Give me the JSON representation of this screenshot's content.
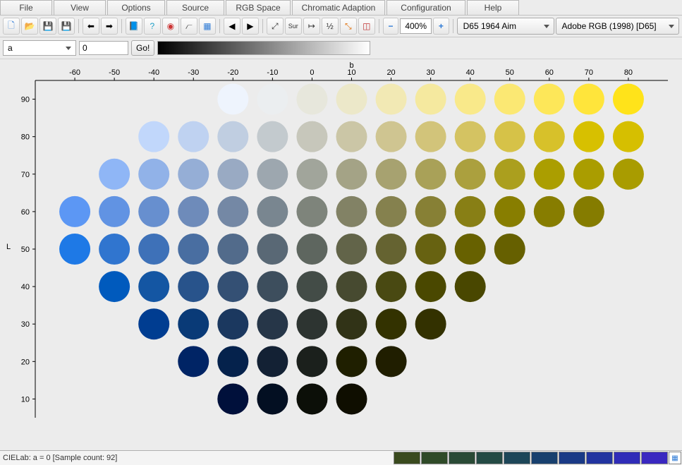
{
  "menubar": {
    "items": [
      {
        "label": "File",
        "w": 72
      },
      {
        "label": "View",
        "w": 72
      },
      {
        "label": "Options",
        "w": 80
      },
      {
        "label": "Source",
        "w": 80
      },
      {
        "label": "RGB Space",
        "w": 90
      },
      {
        "label": "Chromatic Adaption",
        "w": 130
      },
      {
        "label": "Configuration",
        "w": 110
      },
      {
        "label": "Help",
        "w": 72
      }
    ]
  },
  "toolbar": {
    "left_icons": [
      {
        "name": "new-doc-icon",
        "glyph": "🗋",
        "color": "#2d7ad6"
      },
      {
        "name": "open-icon",
        "glyph": "📂",
        "color": "#e2a33a"
      },
      {
        "name": "save-icon",
        "glyph": "💾",
        "color": "#3a6fb7"
      },
      {
        "name": "save-stop-icon",
        "glyph": "💾",
        "color": "#3a6fb7"
      }
    ],
    "nav_icons": [
      {
        "name": "import-icon",
        "glyph": "⬅",
        "color": "#000"
      },
      {
        "name": "export-icon",
        "glyph": "➡",
        "color": "#000"
      }
    ],
    "tool_icons": [
      {
        "name": "book-icon",
        "glyph": "📘",
        "color": "#2d7ad6"
      },
      {
        "name": "info-icon",
        "glyph": "?",
        "color": "#20a0c8"
      },
      {
        "name": "color-wheel-icon",
        "glyph": "◉",
        "color": "#cc3333"
      },
      {
        "name": "curve-icon",
        "glyph": "⦧",
        "color": "#555"
      },
      {
        "name": "palette-icon",
        "glyph": "▦",
        "color": "#2d7ad6"
      }
    ],
    "arrow_icons": [
      {
        "name": "prev-icon",
        "glyph": "◀",
        "color": "#000"
      },
      {
        "name": "next-icon",
        "glyph": "▶",
        "color": "#000"
      }
    ],
    "fit_icons": [
      {
        "name": "resize-icon",
        "glyph": "⤢",
        "color": "#333"
      },
      {
        "name": "sur-icon",
        "glyph": "Sur",
        "color": "#333",
        "small": true
      },
      {
        "name": "spacing-icon",
        "glyph": "↦",
        "color": "#333"
      },
      {
        "name": "half-icon",
        "glyph": "½",
        "color": "#333"
      },
      {
        "name": "expand-icon",
        "glyph": "⤡",
        "color": "#e06a00"
      },
      {
        "name": "bounds-icon",
        "glyph": "◫",
        "color": "#c03333"
      }
    ],
    "zoom": {
      "minus": "−",
      "plus": "+",
      "value": "400%"
    },
    "aim_combo": {
      "label": "D65 1964 Aim"
    },
    "space_combo": {
      "label": "Adobe RGB (1998) [D65]"
    }
  },
  "row2": {
    "selector": {
      "value": "a"
    },
    "input_value": "0",
    "go_label": "Go!"
  },
  "status": {
    "text": "CIELab: a = 0  [Sample count: 92]"
  },
  "chart_data": {
    "type": "scatter",
    "title": "",
    "xlabel": "b",
    "ylabel": "L",
    "x_ticks": [
      -60,
      -50,
      -40,
      -30,
      -20,
      -10,
      0,
      10,
      20,
      30,
      40,
      50,
      60,
      70,
      80
    ],
    "y_ticks": [
      10,
      20,
      30,
      40,
      50,
      60,
      70,
      80,
      90
    ],
    "xlim": [
      -70,
      90
    ],
    "ylim": [
      5,
      95
    ],
    "note": "CIELab gamut slice at a=0; each point is a color swatch at (b,L)",
    "points": [
      {
        "b": -20,
        "L": 90,
        "c": "#eef4fd"
      },
      {
        "b": -10,
        "L": 90,
        "c": "#ebeef0"
      },
      {
        "b": 0,
        "L": 90,
        "c": "#e7e7dc"
      },
      {
        "b": 10,
        "L": 90,
        "c": "#ece8c9"
      },
      {
        "b": 20,
        "L": 90,
        "c": "#f2e9b4"
      },
      {
        "b": 30,
        "L": 90,
        "c": "#f5e99f"
      },
      {
        "b": 40,
        "L": 90,
        "c": "#f9e98a"
      },
      {
        "b": 50,
        "L": 90,
        "c": "#fbe873"
      },
      {
        "b": 60,
        "L": 90,
        "c": "#fde759"
      },
      {
        "b": 70,
        "L": 90,
        "c": "#ffe53b"
      },
      {
        "b": 80,
        "L": 90,
        "c": "#ffe31a"
      },
      {
        "b": -40,
        "L": 80,
        "c": "#c1d7fb"
      },
      {
        "b": -30,
        "L": 80,
        "c": "#bfd2f1"
      },
      {
        "b": -20,
        "L": 80,
        "c": "#c0cee1"
      },
      {
        "b": -10,
        "L": 80,
        "c": "#c3cace"
      },
      {
        "b": 0,
        "L": 80,
        "c": "#c7c7bb"
      },
      {
        "b": 10,
        "L": 80,
        "c": "#cbc6a6"
      },
      {
        "b": 20,
        "L": 80,
        "c": "#cfc591"
      },
      {
        "b": 30,
        "L": 80,
        "c": "#d2c47a"
      },
      {
        "b": 40,
        "L": 80,
        "c": "#d4c362"
      },
      {
        "b": 50,
        "L": 80,
        "c": "#d6c248"
      },
      {
        "b": 60,
        "L": 80,
        "c": "#d7c12a"
      },
      {
        "b": 70,
        "L": 80,
        "c": "#d7c000"
      },
      {
        "b": 80,
        "L": 80,
        "c": "#d6bf00"
      },
      {
        "b": -50,
        "L": 70,
        "c": "#8fb6f6"
      },
      {
        "b": -40,
        "L": 70,
        "c": "#91b2e8"
      },
      {
        "b": -30,
        "L": 70,
        "c": "#95aed6"
      },
      {
        "b": -20,
        "L": 70,
        "c": "#99aac3"
      },
      {
        "b": -10,
        "L": 70,
        "c": "#9da7af"
      },
      {
        "b": 0,
        "L": 70,
        "c": "#a1a59b"
      },
      {
        "b": 10,
        "L": 70,
        "c": "#a4a386"
      },
      {
        "b": 20,
        "L": 70,
        "c": "#a7a270"
      },
      {
        "b": 30,
        "L": 70,
        "c": "#a9a158"
      },
      {
        "b": 40,
        "L": 70,
        "c": "#aba03e"
      },
      {
        "b": 50,
        "L": 70,
        "c": "#ab9f1e"
      },
      {
        "b": 60,
        "L": 70,
        "c": "#ab9e00"
      },
      {
        "b": 70,
        "L": 70,
        "c": "#aa9d00"
      },
      {
        "b": 80,
        "L": 70,
        "c": "#a99c00"
      },
      {
        "b": -60,
        "L": 60,
        "c": "#5c97f4"
      },
      {
        "b": -50,
        "L": 60,
        "c": "#6193e3"
      },
      {
        "b": -40,
        "L": 60,
        "c": "#678fcf"
      },
      {
        "b": -30,
        "L": 60,
        "c": "#6e8bba"
      },
      {
        "b": -20,
        "L": 60,
        "c": "#7488a5"
      },
      {
        "b": -10,
        "L": 60,
        "c": "#798690"
      },
      {
        "b": 0,
        "L": 60,
        "c": "#7e847b"
      },
      {
        "b": 10,
        "L": 60,
        "c": "#828265"
      },
      {
        "b": 20,
        "L": 60,
        "c": "#85814e"
      },
      {
        "b": 30,
        "L": 60,
        "c": "#878035"
      },
      {
        "b": 40,
        "L": 60,
        "c": "#887f15"
      },
      {
        "b": 50,
        "L": 60,
        "c": "#887e00"
      },
      {
        "b": 60,
        "L": 60,
        "c": "#877d00"
      },
      {
        "b": 70,
        "L": 60,
        "c": "#857c00"
      },
      {
        "b": -60,
        "L": 50,
        "c": "#1e79e6"
      },
      {
        "b": -50,
        "L": 50,
        "c": "#3075cf"
      },
      {
        "b": -40,
        "L": 50,
        "c": "#3e71b8"
      },
      {
        "b": -30,
        "L": 50,
        "c": "#496ea1"
      },
      {
        "b": -20,
        "L": 50,
        "c": "#526b8b"
      },
      {
        "b": -10,
        "L": 50,
        "c": "#596875"
      },
      {
        "b": 0,
        "L": 50,
        "c": "#5e665f"
      },
      {
        "b": 10,
        "L": 50,
        "c": "#626449"
      },
      {
        "b": 20,
        "L": 50,
        "c": "#656331"
      },
      {
        "b": 30,
        "L": 50,
        "c": "#676211"
      },
      {
        "b": 40,
        "L": 50,
        "c": "#676100"
      },
      {
        "b": 50,
        "L": 50,
        "c": "#666000"
      },
      {
        "b": -50,
        "L": 40,
        "c": "#005abd"
      },
      {
        "b": -40,
        "L": 40,
        "c": "#1456a3"
      },
      {
        "b": -30,
        "L": 40,
        "c": "#28538b"
      },
      {
        "b": -20,
        "L": 40,
        "c": "#345074"
      },
      {
        "b": -10,
        "L": 40,
        "c": "#3d4e5d"
      },
      {
        "b": 0,
        "L": 40,
        "c": "#434c47"
      },
      {
        "b": 10,
        "L": 40,
        "c": "#474a30"
      },
      {
        "b": 20,
        "L": 40,
        "c": "#494912"
      },
      {
        "b": 30,
        "L": 40,
        "c": "#4a4800"
      },
      {
        "b": 40,
        "L": 40,
        "c": "#494700"
      },
      {
        "b": -40,
        "L": 30,
        "c": "#003d91"
      },
      {
        "b": -30,
        "L": 30,
        "c": "#093a77"
      },
      {
        "b": -20,
        "L": 30,
        "c": "#1b385f"
      },
      {
        "b": -10,
        "L": 30,
        "c": "#263648"
      },
      {
        "b": 0,
        "L": 30,
        "c": "#2d3431"
      },
      {
        "b": 10,
        "L": 30,
        "c": "#313317"
      },
      {
        "b": 20,
        "L": 30,
        "c": "#333200"
      },
      {
        "b": 30,
        "L": 30,
        "c": "#333100"
      },
      {
        "b": -30,
        "L": 20,
        "c": "#002465"
      },
      {
        "b": -20,
        "L": 20,
        "c": "#05224c"
      },
      {
        "b": -10,
        "L": 20,
        "c": "#132134"
      },
      {
        "b": 0,
        "L": 20,
        "c": "#1b201c"
      },
      {
        "b": 10,
        "L": 20,
        "c": "#1f1f00"
      },
      {
        "b": 20,
        "L": 20,
        "c": "#201e00"
      },
      {
        "b": -20,
        "L": 10,
        "c": "#00103b"
      },
      {
        "b": -10,
        "L": 10,
        "c": "#030f22"
      },
      {
        "b": 0,
        "L": 10,
        "c": "#0c0f08"
      },
      {
        "b": 10,
        "L": 10,
        "c": "#0f0e00"
      }
    ]
  },
  "status_swatches": [
    "#3a4a1e",
    "#2f4a28",
    "#2a4a36",
    "#244a44",
    "#1d4658",
    "#18406e",
    "#1a3a86",
    "#2234a0",
    "#302cb8",
    "#3a28c0"
  ],
  "status_end_swatch_icon": "▦"
}
